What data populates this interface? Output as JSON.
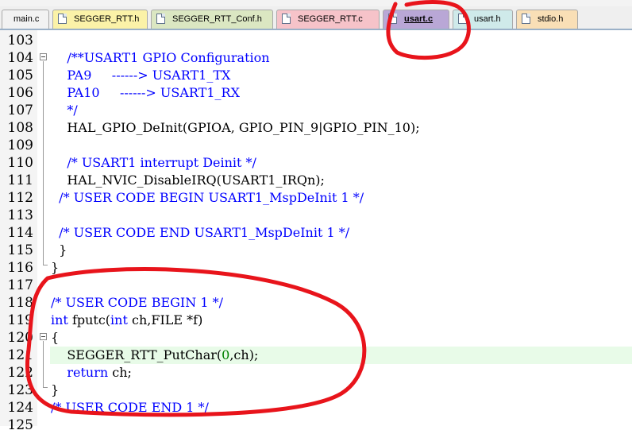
{
  "tabs": [
    {
      "label": "main.c",
      "active": false
    },
    {
      "label": "SEGGER_RTT.h",
      "active": false
    },
    {
      "label": "SEGGER_RTT_Conf.h",
      "active": false
    },
    {
      "label": "SEGGER_RTT.c",
      "active": false
    },
    {
      "label": "usart.c",
      "active": true
    },
    {
      "label": "usart.h",
      "active": false
    },
    {
      "label": "stdio.h",
      "active": false
    }
  ],
  "lines": [
    {
      "num": "103",
      "tokens": []
    },
    {
      "num": "104",
      "tokens": [
        {
          "t": "    /**USART1 GPIO Configuration",
          "c": "comment"
        }
      ]
    },
    {
      "num": "105",
      "tokens": [
        {
          "t": "    PA9     ------> USART1_TX",
          "c": "comment"
        }
      ]
    },
    {
      "num": "106",
      "tokens": [
        {
          "t": "    PA10     ------> USART1_RX",
          "c": "comment"
        }
      ]
    },
    {
      "num": "107",
      "tokens": [
        {
          "t": "    */",
          "c": "comment"
        }
      ]
    },
    {
      "num": "108",
      "tokens": [
        {
          "t": "    HAL_GPIO_DeInit(GPIOA, GPIO_PIN_9|GPIO_PIN_10);",
          "c": "plain"
        }
      ]
    },
    {
      "num": "109",
      "tokens": []
    },
    {
      "num": "110",
      "tokens": [
        {
          "t": "    /* USART1 interrupt Deinit */",
          "c": "comment"
        }
      ]
    },
    {
      "num": "111",
      "tokens": [
        {
          "t": "    HAL_NVIC_DisableIRQ(USART1_IRQn);",
          "c": "plain"
        }
      ]
    },
    {
      "num": "112",
      "tokens": [
        {
          "t": "  /* USER CODE BEGIN USART1_MspDeInit 1 */",
          "c": "comment"
        }
      ]
    },
    {
      "num": "113",
      "tokens": []
    },
    {
      "num": "114",
      "tokens": [
        {
          "t": "  /* USER CODE END USART1_MspDeInit 1 */",
          "c": "comment"
        }
      ]
    },
    {
      "num": "115",
      "tokens": [
        {
          "t": "  }",
          "c": "plain"
        }
      ]
    },
    {
      "num": "116",
      "tokens": [
        {
          "t": "}",
          "c": "plain"
        }
      ]
    },
    {
      "num": "117",
      "tokens": []
    },
    {
      "num": "118",
      "tokens": [
        {
          "t": "/* USER CODE BEGIN 1 */",
          "c": "comment"
        }
      ]
    },
    {
      "num": "119",
      "tokens": [
        {
          "t": "int",
          "c": "keyword"
        },
        {
          "t": " fputc(",
          "c": "plain"
        },
        {
          "t": "int",
          "c": "keyword"
        },
        {
          "t": " ch,FILE *f)",
          "c": "plain"
        }
      ]
    },
    {
      "num": "120",
      "tokens": [
        {
          "t": "{",
          "c": "plain"
        }
      ]
    },
    {
      "num": "121",
      "tokens": [
        {
          "t": "    SEGGER_RTT_PutChar(",
          "c": "plain"
        },
        {
          "t": "0",
          "c": "number"
        },
        {
          "t": ",ch);",
          "c": "plain"
        }
      ],
      "highlight": true
    },
    {
      "num": "122",
      "tokens": [
        {
          "t": "    return",
          "c": "keyword"
        },
        {
          "t": " ch;",
          "c": "plain"
        }
      ]
    },
    {
      "num": "123",
      "tokens": [
        {
          "t": "}",
          "c": "plain"
        }
      ]
    },
    {
      "num": "124",
      "tokens": [
        {
          "t": "/* USER CODE END 1 */",
          "c": "comment"
        }
      ]
    },
    {
      "num": "125",
      "tokens": []
    }
  ],
  "colors": {
    "comment": "#0000ff",
    "keyword": "#0000ff",
    "number": "#008000",
    "annotation": "#e8141b",
    "active_tab": "#b9a7d6"
  }
}
